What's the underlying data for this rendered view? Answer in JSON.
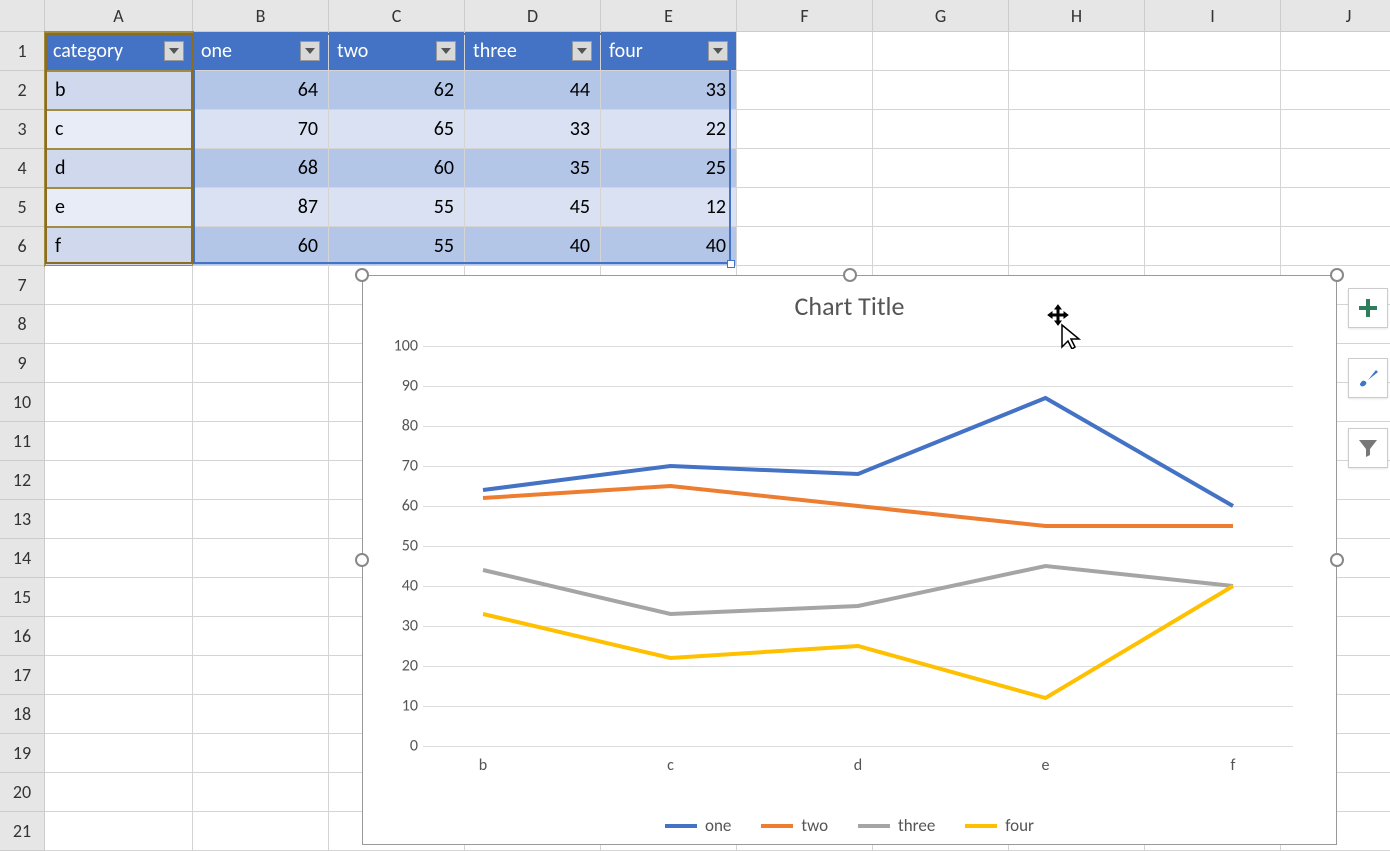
{
  "columns": [
    "A",
    "B",
    "C",
    "D",
    "E",
    "F",
    "G",
    "H",
    "I",
    "J"
  ],
  "table": {
    "headers": [
      "category",
      "one",
      "two",
      "three",
      "four"
    ],
    "rows": [
      {
        "cat": "b",
        "one": 64,
        "two": 62,
        "three": 44,
        "four": 33
      },
      {
        "cat": "c",
        "one": 70,
        "two": 65,
        "three": 33,
        "four": 22
      },
      {
        "cat": "d",
        "one": 68,
        "two": 60,
        "three": 35,
        "four": 25
      },
      {
        "cat": "e",
        "one": 87,
        "two": 55,
        "three": 45,
        "four": 12
      },
      {
        "cat": "f",
        "one": 60,
        "two": 55,
        "three": 40,
        "four": 40
      }
    ]
  },
  "chart_data": {
    "type": "line",
    "title": "Chart Title",
    "categories": [
      "b",
      "c",
      "d",
      "e",
      "f"
    ],
    "series": [
      {
        "name": "one",
        "values": [
          64,
          70,
          68,
          87,
          60
        ],
        "color": "#4472c4"
      },
      {
        "name": "two",
        "values": [
          62,
          65,
          60,
          55,
          55
        ],
        "color": "#ed7d31"
      },
      {
        "name": "three",
        "values": [
          44,
          33,
          35,
          45,
          40
        ],
        "color": "#a5a5a5"
      },
      {
        "name": "four",
        "values": [
          33,
          22,
          25,
          12,
          40
        ],
        "color": "#ffc000"
      }
    ],
    "ylim": [
      0,
      100
    ],
    "ystep": 10,
    "xlabel": "",
    "ylabel": ""
  },
  "row_count": 21,
  "side_buttons": [
    "plus-icon",
    "brush-icon",
    "funnel-icon"
  ]
}
